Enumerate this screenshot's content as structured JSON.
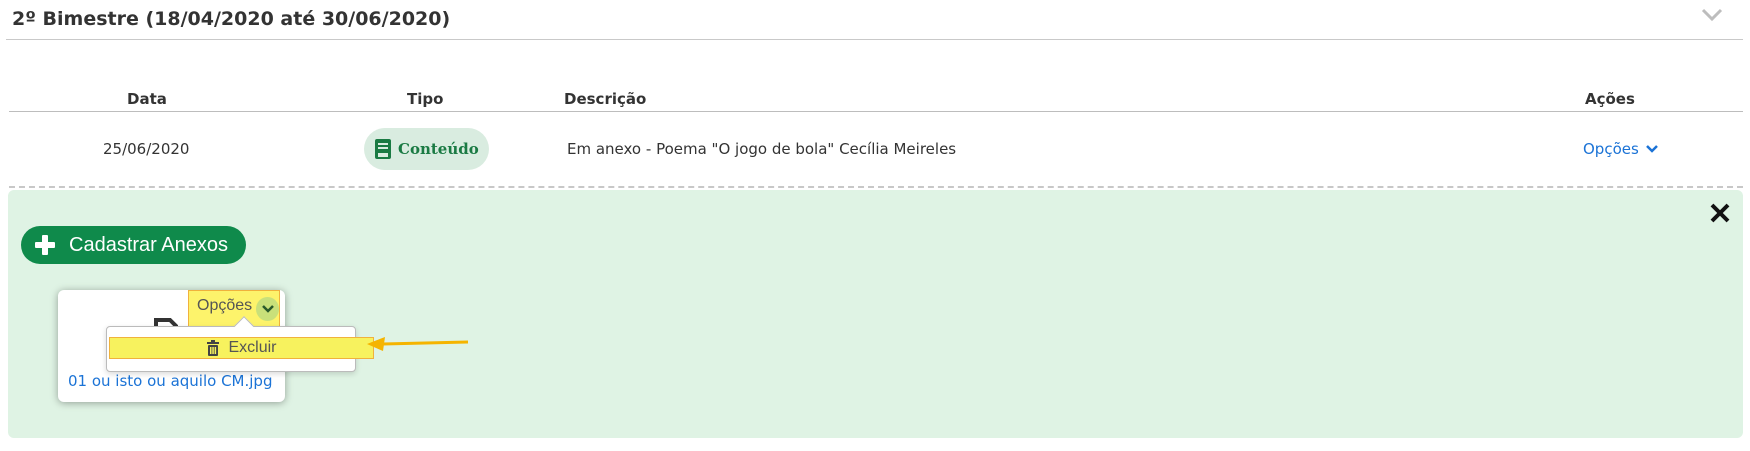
{
  "section": {
    "title": "2º Bimestre (18/04/2020 até 30/06/2020)",
    "collapse_icon": "chevron-down-icon"
  },
  "table": {
    "headers": {
      "data": "Data",
      "tipo": "Tipo",
      "descricao": "Descrição",
      "acoes": "Ações"
    },
    "rows": [
      {
        "data": "25/06/2020",
        "tipo": "Conteúdo",
        "tipo_icon": "book-icon",
        "descricao": "Em anexo - Poema \"O jogo de bola\" Cecília Meireles",
        "acoes": "Opções"
      }
    ]
  },
  "attachments": {
    "add_button": "Cadastrar Anexos",
    "close_icon": "close-icon",
    "files": [
      {
        "name": "01 ou isto ou aquilo CM.jpg",
        "options_label": "Opções",
        "menu": [
          {
            "label": "Excluir",
            "icon": "trash-icon"
          }
        ]
      }
    ]
  },
  "colors": {
    "brand_green": "#0f8a4b",
    "panel_bg": "#dff3e4",
    "link_blue": "#1b73d6",
    "highlight_yellow": "#f7f25e",
    "arrow_orange": "#f5b400"
  }
}
